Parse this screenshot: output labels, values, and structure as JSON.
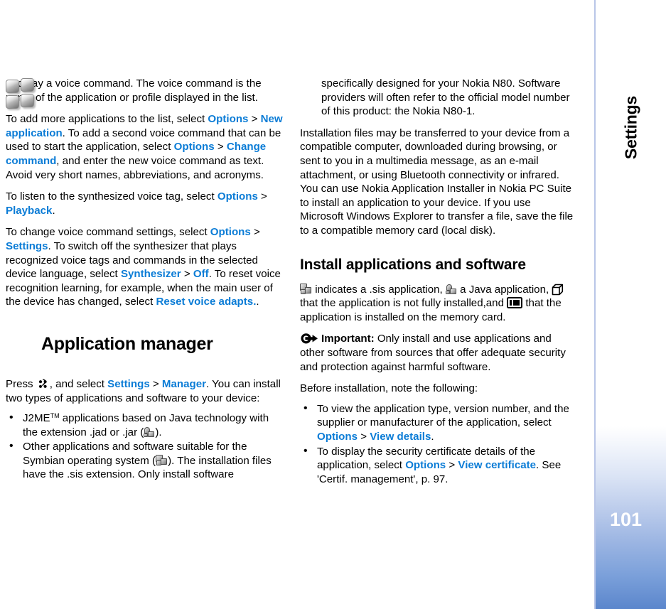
{
  "sidebar": {
    "chapter_label": "Settings",
    "page_number": "101",
    "accent_color": "#5b86cc",
    "border_color": "#b9c6e8"
  },
  "link_color": "#0b7cd6",
  "left_column": {
    "p1": {
      "text": "and say a voice command. The voice command is the name of the application or profile displayed in the list."
    },
    "p2": {
      "seg1": "To add more applications to the list, select ",
      "link1": "Options",
      "sep1": " > ",
      "link2": "New application",
      "seg2": ". To add a second voice command that can be used to start the application, select ",
      "link3": "Options",
      "sep2": " > ",
      "link4": "Change command",
      "seg3": ", and enter the new voice command as text. Avoid very short names, abbreviations, and acronyms."
    },
    "p3": {
      "seg1": "To listen to the synthesized voice tag, select ",
      "link1": "Options",
      "sep1": " > ",
      "link2": "Playback",
      "seg2": "."
    },
    "p4": {
      "seg1": "To change voice command settings, select ",
      "link1": "Options",
      "sep1": " > ",
      "link2": "Settings",
      "seg2": ". To switch off the synthesizer that plays recognized voice tags and commands in the selected device language, select ",
      "link3": "Synthesizer",
      "sep2": " > ",
      "link4": "Off",
      "seg3": ". To reset voice recognition learning, for example, when the main user of the device has changed, select ",
      "link5": "Reset voice adapts.",
      "seg4": "."
    },
    "section_heading": "Application manager",
    "section_icon": "application-manager-icon",
    "p5": {
      "seg1": "Press ",
      "icon": "menu-key-icon",
      "seg2": ", and select ",
      "link1": "Settings",
      "sep1": " > ",
      "link2": "Manager",
      "seg3": ". You can install two types of applications and software to your device:"
    },
    "bullets": [
      {
        "seg1": "J2ME",
        "sup": "TM",
        "seg2": " applications based on Java technology with the extension .jad or .jar (",
        "icon": "java-application-icon",
        "seg3": ")."
      },
      {
        "seg1": "Other applications and software suitable for the Symbian operating system (",
        "icon": "sis-application-icon",
        "seg2": "). The installation files have the .sis extension. Only install software"
      }
    ]
  },
  "right_column": {
    "p1_continuation": "specifically designed for your Nokia N80. Software providers will often refer to the official model number of this product: the Nokia N80-1.",
    "p2": "Installation files may be transferred to your device from a compatible computer, downloaded during browsing, or sent to you in a multimedia message, as an e-mail attachment, or using Bluetooth connectivity or infrared. You can use Nokia Application Installer in Nokia PC Suite to install an application to your device. If you use Microsoft Windows Explorer to transfer a file, save the file to a compatible memory card (local disk).",
    "heading": "Install applications and software",
    "legend": {
      "icon1": "sis-application-icon",
      "seg1": " indicates a .sis application, ",
      "icon2": "java-application-icon",
      "seg2": " a Java application, ",
      "icon3": "not-fully-installed-cube-icon",
      "seg3": " that the application is not fully installed,and ",
      "icon4": "memory-card-icon",
      "seg4": " that the application is installed on the memory card."
    },
    "important": {
      "icon": "important-arrow-icon",
      "label": "Important:",
      "text": " Only install and use applications and other software from sources that offer adequate security and protection against harmful software."
    },
    "before_install_lead": "Before installation, note the following:",
    "bullets": [
      {
        "seg1": "To view the application type, version number, and the supplier or manufacturer of the application, select ",
        "link1": "Options",
        "sep1": " > ",
        "link2": "View details",
        "seg2": "."
      },
      {
        "seg1": "To display the security certificate details of the application, select ",
        "link1": "Options",
        "sep1": " > ",
        "link2": "View certificate",
        "seg2": ". See 'Certif. management', p. 97."
      }
    ]
  }
}
